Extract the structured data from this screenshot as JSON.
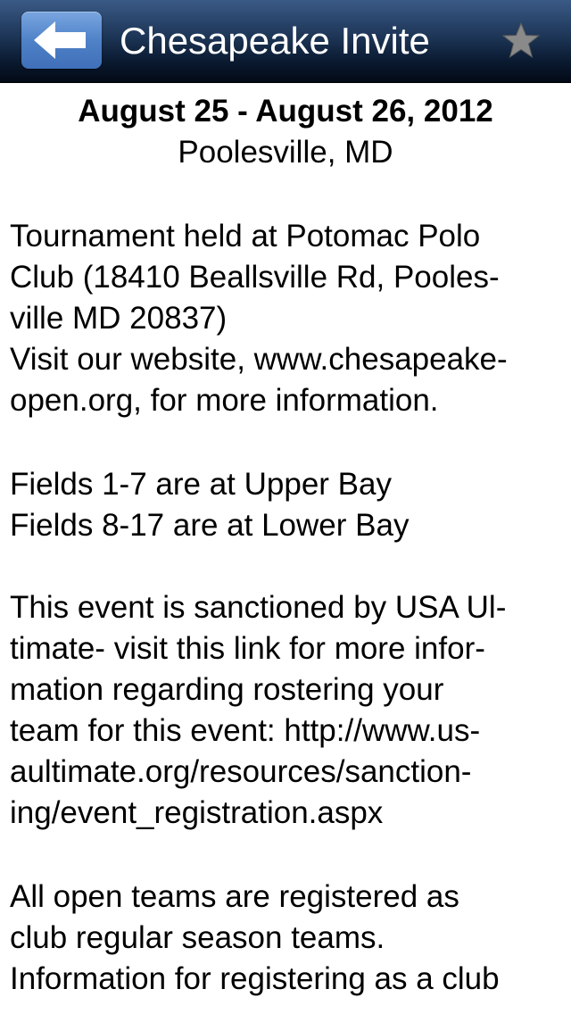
{
  "nav": {
    "title": "Chesapeake Invite",
    "back_icon": "back-arrow-icon",
    "star_icon": "star-icon"
  },
  "header": {
    "date": "August 25 - August 26, 2012",
    "location": "Poolesville, MD"
  },
  "body_lines": [
    "Tournament held at Potomac Polo",
    "Club (18410 Beallsville Rd, Pooles-",
    "ville MD 20837)",
    "Visit our website, www.chesapeake-",
    "open.org, for more information.",
    "Fields 1-7 are at Upper Bay",
    "Fields 8-17 are at Lower Bay",
    "This event is sanctioned by USA Ul-",
    "timate- visit this link for more infor-",
    "mation regarding rostering your",
    "team for this event: http://www.us-",
    "aultimate.org/resources/sanction-",
    "ing/event_registration.aspx",
    "All open teams are registered as",
    "club regular season teams.",
    "Information for registering as a club"
  ],
  "colors": {
    "nav_bar": "#0a1a30",
    "back_button": "#4f82c8",
    "star": "#8a8a8a"
  }
}
